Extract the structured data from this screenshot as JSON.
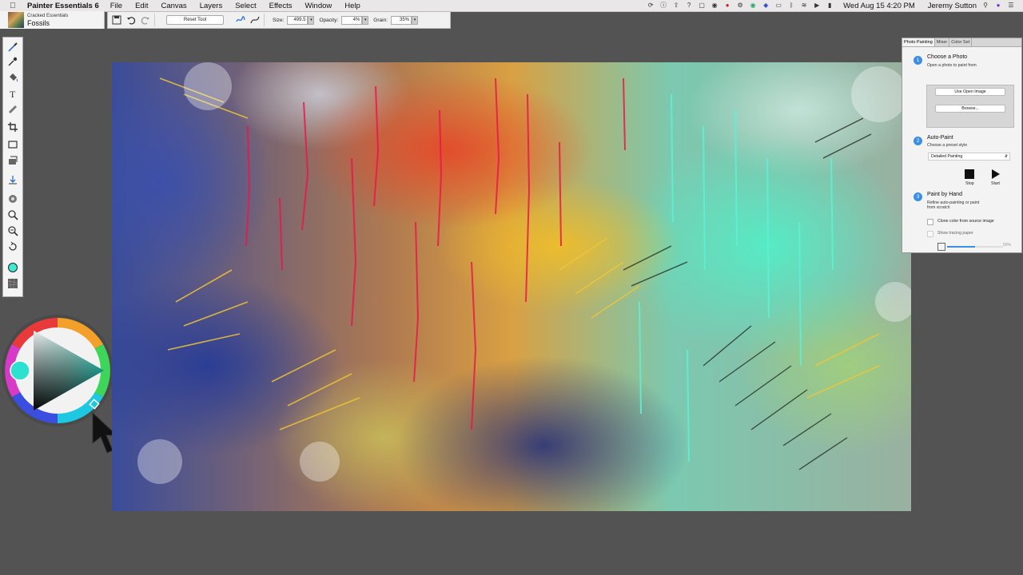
{
  "menubar": {
    "app_name": "Painter Essentials 6",
    "menus": [
      "File",
      "Edit",
      "Canvas",
      "Layers",
      "Select",
      "Effects",
      "Window",
      "Help"
    ],
    "clock": "Wed Aug 15  4:20 PM",
    "user": "Jeremy Sutton"
  },
  "brush_selector": {
    "category": "Cracked Essentials",
    "variant": "Fossils"
  },
  "property_bar": {
    "reset_tool_label": "Reset Tool",
    "size_label": "Size:",
    "size_value": "499.5",
    "opacity_label": "Opacity:",
    "opacity_value": "4%",
    "grain_label": "Grain:",
    "grain_value": "35%"
  },
  "colors": {
    "current_color": "#3ee8d2",
    "accent": "#3a8ee6"
  },
  "photo_painting_panel": {
    "tabs": [
      "Photo Painting",
      "Mixer",
      "Color Set"
    ],
    "active_tab": 0,
    "step1": {
      "number": "1",
      "title": "Choose a Photo",
      "subtitle": "Open a photo to paint from",
      "use_open_image": "Use Open Image",
      "browse": "Browse..."
    },
    "step2": {
      "number": "2",
      "title": "Auto-Paint",
      "subtitle": "Choose a preset style",
      "style": "Detailed Painting",
      "stop": "Stop",
      "start": "Start"
    },
    "step3": {
      "number": "3",
      "title": "Paint by Hand",
      "subtitle_line1": "Refine auto-painting or paint",
      "subtitle_line2": "from scratch",
      "clone_color": "Clone color from source image",
      "show_tracing": "Show tracing paper",
      "tracing_opacity": "50%",
      "tracing_opacity_fraction": 0.5
    }
  }
}
